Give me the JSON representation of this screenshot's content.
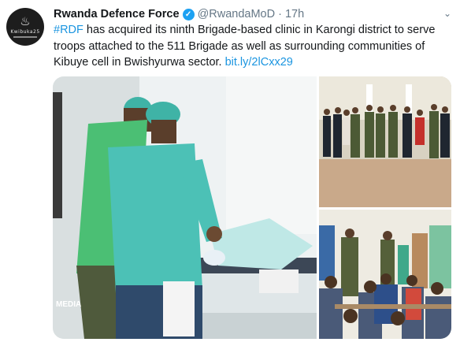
{
  "tweet": {
    "author_name": "Rwanda Defence Force",
    "handle": "@RwandaMoD",
    "separator": "·",
    "time": "17h",
    "avatar_text": "Kwibuka25",
    "text_hashtag": "#RDF",
    "text_body": " has acquired its ninth Brigade-based clinic in Karongi district to serve troops attached to the 511 Brigade as well as surrounding communities of Kibuye cell in Bwishyurwa sector. ",
    "text_link": "bit.ly/2lCxx29",
    "photo_watermark": "MEDIA"
  },
  "icons": {
    "verified": "verified-badge-icon",
    "menu": "chevron-down-icon"
  },
  "colors": {
    "link": "#1b95e0",
    "verified": "#1da1f2",
    "muted": "#657786",
    "scrubs": "#3fb3a6"
  }
}
